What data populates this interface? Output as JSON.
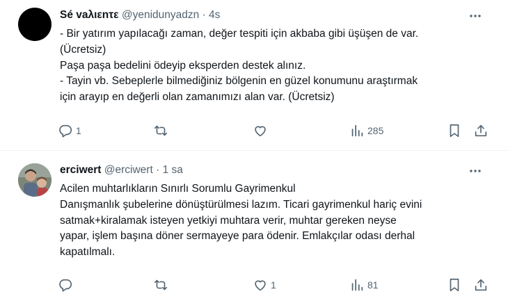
{
  "tweets": [
    {
      "name": "Sé vaλιεnτε",
      "handle": "@yenidunyadzn",
      "separator": "·",
      "time": "4s",
      "lines": [
        "- Bir yatırım yapılacağı zaman, değer tespiti için akbaba gibi üşüşen de var.",
        "(Ücretsiz)",
        "Paşa paşa bedelini ödeyip eksperden destek alınız.",
        "- Tayin  vb. Sebeplerle bilmediğiniz bölgenin en güzel konumunu araştırmak",
        "için arayıp en değerli olan zamanımızı alan var. (Ücretsiz)"
      ],
      "replies": "1",
      "retweets": "",
      "likes": "",
      "views": "285"
    },
    {
      "name": "erciwert",
      "handle": "@erciwert",
      "separator": "·",
      "time": "1 sa",
      "lines": [
        "Acilen muhtarlıkların Sınırlı Sorumlu Gayrimenkul",
        "Danışmanlık şubelerine dönüştürülmesi lazım. Ticari gayrimenkul hariç evini",
        "satmak+kiralamak isteyen yetkiyi muhtara verir, muhtar gereken neyse",
        "yapar, işlem başına döner sermayeye para ödenir. Emlakçılar odası derhal",
        "kapatılmalı."
      ],
      "replies": "",
      "retweets": "",
      "likes": "1",
      "views": "81"
    }
  ],
  "icons": {
    "more": "more-dots-icon",
    "reply": "reply-bubble-icon",
    "retweet": "retweet-arrows-icon",
    "like": "heart-icon",
    "views": "views-bar-chart-icon",
    "bookmark": "bookmark-icon",
    "share": "share-upload-icon"
  },
  "colors": {
    "text": "#0f1419",
    "secondary": "#536471",
    "divider": "#eff3f4"
  }
}
